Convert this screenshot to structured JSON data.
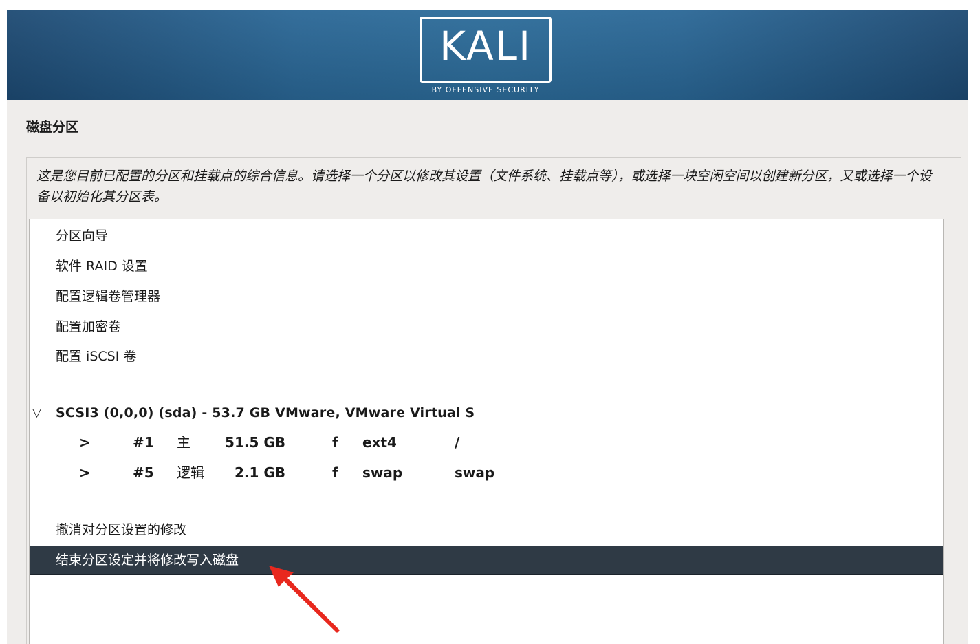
{
  "banner": {
    "logo_text": "KALI",
    "logo_subtitle": "BY OFFENSIVE SECURITY"
  },
  "page": {
    "title": "磁盘分区",
    "description": "这是您目前已配置的分区和挂载点的综合信息。请选择一个分区以修改其设置（文件系统、挂载点等），或选择一块空闲空间以创建新分区，又或选择一个设备以初始化其分区表。"
  },
  "menu": {
    "items": [
      {
        "label": "分区向导"
      },
      {
        "label": "软件 RAID 设置"
      },
      {
        "label": "配置逻辑卷管理器"
      },
      {
        "label": "配置加密卷"
      },
      {
        "label": "配置 iSCSI 卷"
      }
    ],
    "disk": {
      "expand_glyph": "▽",
      "label": "SCSI3 (0,0,0) (sda) - 53.7 GB VMware, VMware Virtual S",
      "partitions": [
        {
          "arrow": ">",
          "number": "#1",
          "type": "主",
          "size": "51.5 GB",
          "flag": "f",
          "fs": "ext4",
          "mount": "/"
        },
        {
          "arrow": ">",
          "number": "#5",
          "type": "逻辑",
          "size": "2.1 GB",
          "flag": "f",
          "fs": "swap",
          "mount": "swap"
        }
      ]
    },
    "undo_label": "撤消对分区设置的修改",
    "finish_label": "结束分区设定并将修改写入磁盘",
    "selected": "finish"
  },
  "annotation": {
    "arrow_color": "#e8281e"
  }
}
